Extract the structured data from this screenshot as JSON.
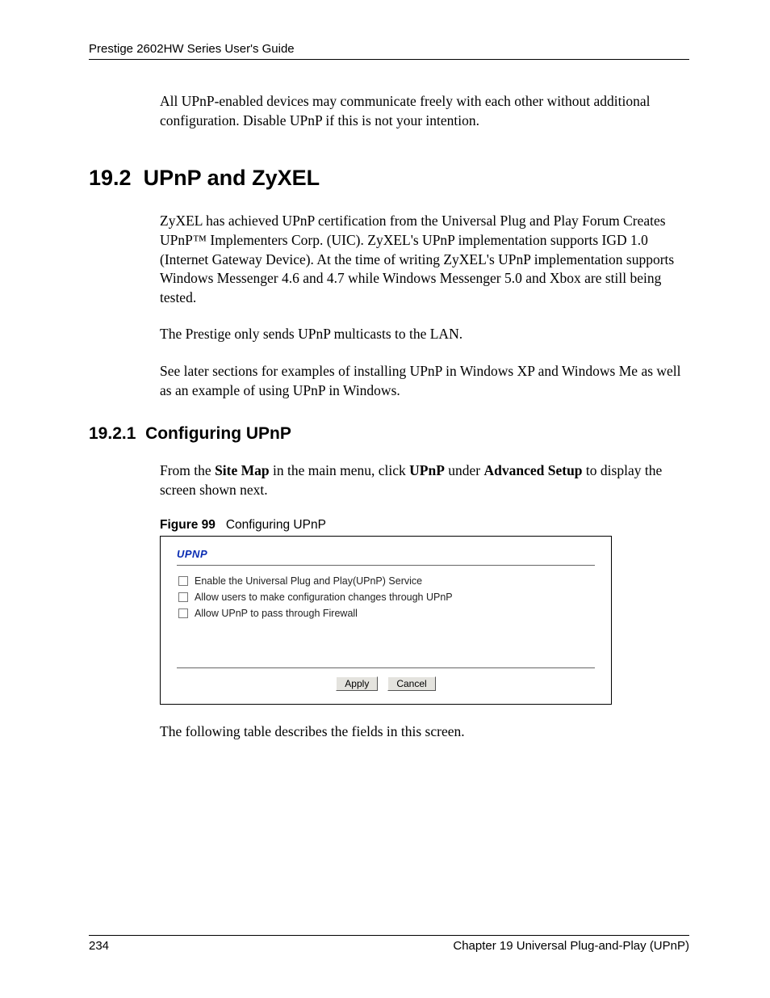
{
  "header": {
    "title": "Prestige 2602HW Series User's Guide"
  },
  "intro_para": "All UPnP-enabled devices may communicate freely with each other without additional configuration. Disable UPnP if this is not your intention.",
  "section": {
    "number": "19.2",
    "title": "UPnP and ZyXEL",
    "paragraphs": [
      "ZyXEL has achieved UPnP certification from the Universal Plug and Play Forum Creates UPnP™ Implementers Corp. (UIC). ZyXEL's UPnP implementation supports IGD 1.0 (Internet Gateway Device). At the time of writing ZyXEL's UPnP implementation supports Windows Messenger 4.6 and 4.7 while Windows Messenger 5.0 and Xbox are still being tested.",
      "The Prestige only sends UPnP multicasts to the LAN.",
      "See later sections for examples of installing UPnP in Windows XP and Windows Me as well as an example of using UPnP in Windows."
    ]
  },
  "subsection": {
    "number": "19.2.1",
    "title": "Configuring UPnP",
    "intro_pre": "From the ",
    "intro_bold1": "Site Map",
    "intro_mid1": " in the main menu, click ",
    "intro_bold2": "UPnP",
    "intro_mid2": " under ",
    "intro_bold3": "Advanced Setup",
    "intro_post": " to display the screen shown next."
  },
  "figure": {
    "label": "Figure 99",
    "caption": "Configuring UPnP",
    "panel_title": "UPNP",
    "checkboxes": [
      "Enable the Universal Plug and Play(UPnP) Service",
      "Allow users to make configuration changes through UPnP",
      "Allow UPnP to pass through Firewall"
    ],
    "buttons": {
      "apply": "Apply",
      "cancel": "Cancel"
    }
  },
  "trailing_para": "The following table describes the fields in this screen.",
  "footer": {
    "page": "234",
    "chapter": "Chapter 19 Universal Plug-and-Play (UPnP)"
  }
}
